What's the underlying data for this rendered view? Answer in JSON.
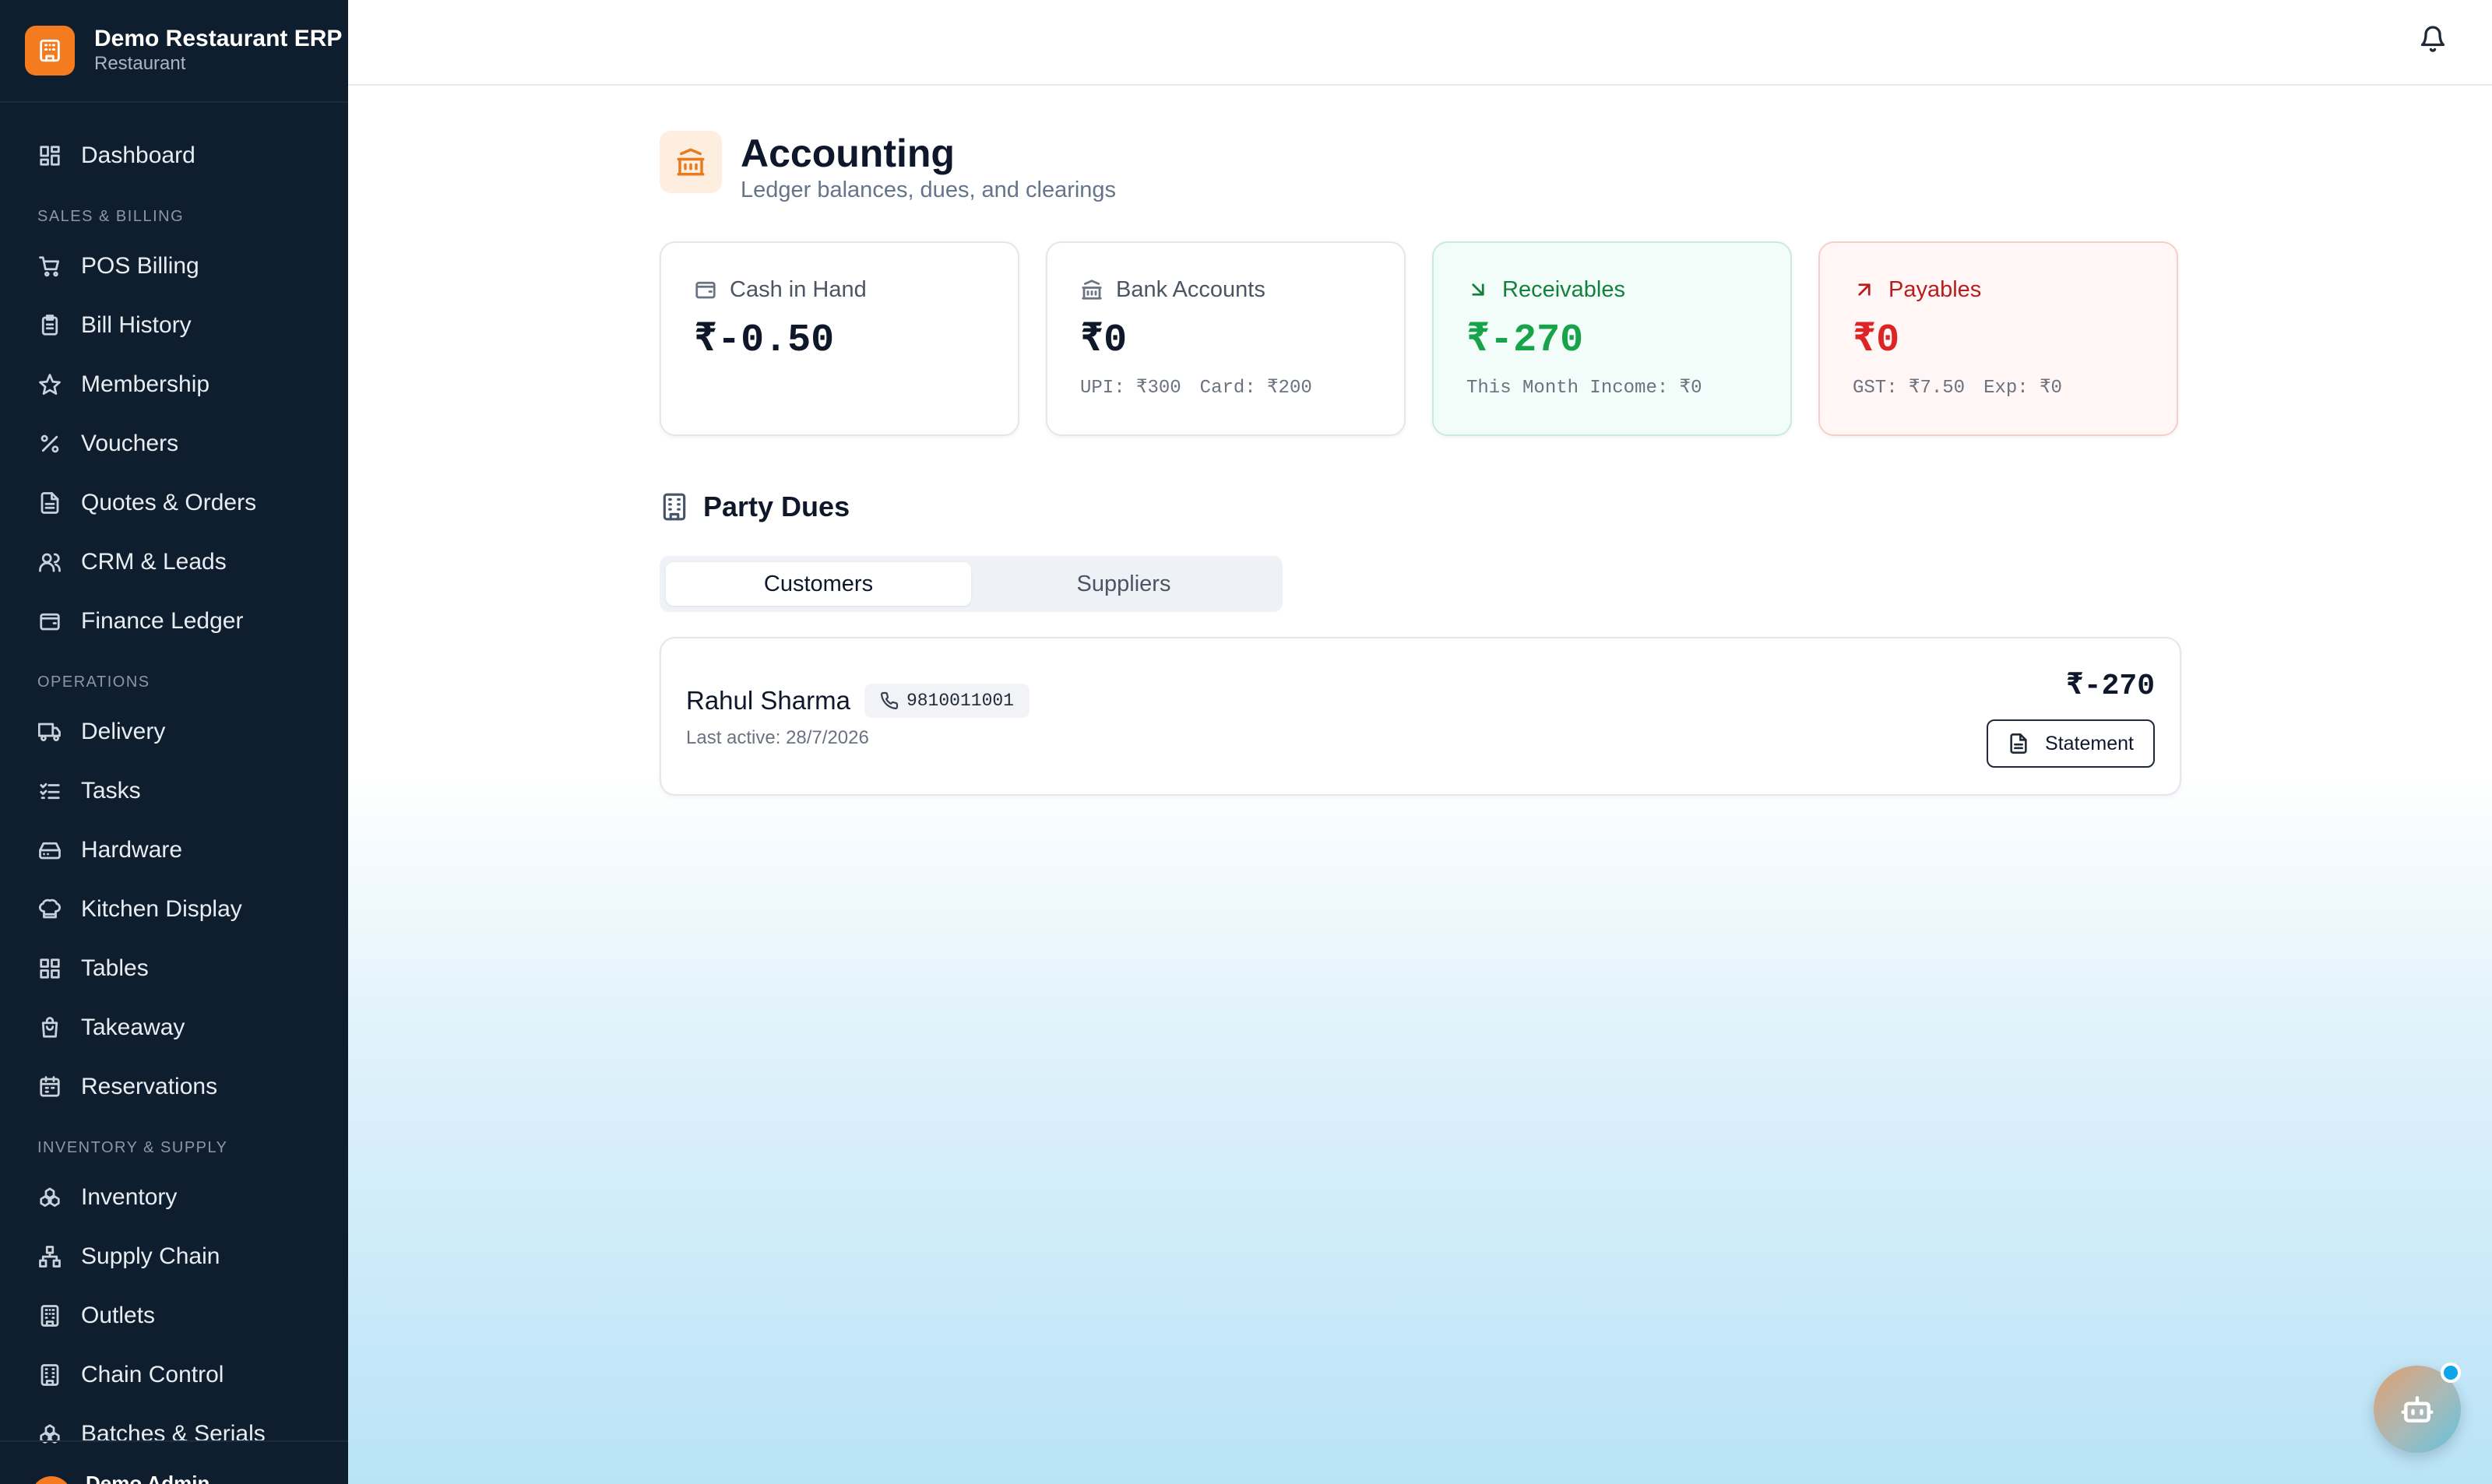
{
  "brand": {
    "name": "Demo Restaurant ERP",
    "subtitle": "Restaurant"
  },
  "sidebar": {
    "dashboard": "Dashboard",
    "sections": [
      {
        "label": "SALES & BILLING",
        "items": [
          {
            "label": "POS Billing",
            "icon": "cart-icon"
          },
          {
            "label": "Bill History",
            "icon": "clipboard-icon"
          },
          {
            "label": "Membership",
            "icon": "star-icon"
          },
          {
            "label": "Vouchers",
            "icon": "percent-icon"
          },
          {
            "label": "Quotes & Orders",
            "icon": "document-icon"
          },
          {
            "label": "CRM & Leads",
            "icon": "users-icon"
          },
          {
            "label": "Finance Ledger",
            "icon": "wallet-icon"
          }
        ]
      },
      {
        "label": "OPERATIONS",
        "items": [
          {
            "label": "Delivery",
            "icon": "truck-icon"
          },
          {
            "label": "Tasks",
            "icon": "checklist-icon"
          },
          {
            "label": "Hardware",
            "icon": "hard-drive-icon"
          },
          {
            "label": "Kitchen Display",
            "icon": "chef-hat-icon"
          },
          {
            "label": "Tables",
            "icon": "grid-icon"
          },
          {
            "label": "Takeaway",
            "icon": "bag-icon"
          },
          {
            "label": "Reservations",
            "icon": "calendar-icon"
          }
        ]
      },
      {
        "label": "INVENTORY & SUPPLY",
        "items": [
          {
            "label": "Inventory",
            "icon": "boxes-icon"
          },
          {
            "label": "Supply Chain",
            "icon": "network-icon"
          },
          {
            "label": "Outlets",
            "icon": "building-icon"
          },
          {
            "label": "Chain Control",
            "icon": "building-icon"
          },
          {
            "label": "Batches & Serials",
            "icon": "boxes-icon"
          }
        ]
      }
    ],
    "user": "Demo Admin"
  },
  "page": {
    "title": "Accounting",
    "subtitle": "Ledger balances, dues, and clearings"
  },
  "cards": {
    "cash": {
      "label": "Cash in Hand",
      "value": "₹-0.50"
    },
    "bank": {
      "label": "Bank Accounts",
      "value": "₹0",
      "upi": "UPI: ₹300",
      "card": "Card: ₹200"
    },
    "receivables": {
      "label": "Receivables",
      "value": "₹-270",
      "meta": "This Month Income: ₹0"
    },
    "payables": {
      "label": "Payables",
      "value": "₹0",
      "gst": "GST: ₹7.50",
      "exp": "Exp: ₹0"
    }
  },
  "party_dues": {
    "title": "Party Dues",
    "tabs": [
      "Customers",
      "Suppliers"
    ],
    "active_tab": "Customers",
    "rows": [
      {
        "name": "Rahul Sharma",
        "phone": "9810011001",
        "last_active": "Last active: 28/7/2026",
        "amount": "₹-270",
        "action": "Statement"
      }
    ]
  },
  "colors": {
    "accent": "#f47b20",
    "sidebar_bg": "#0f1e2e",
    "positive": "#16a34a",
    "negative": "#dc2626"
  }
}
